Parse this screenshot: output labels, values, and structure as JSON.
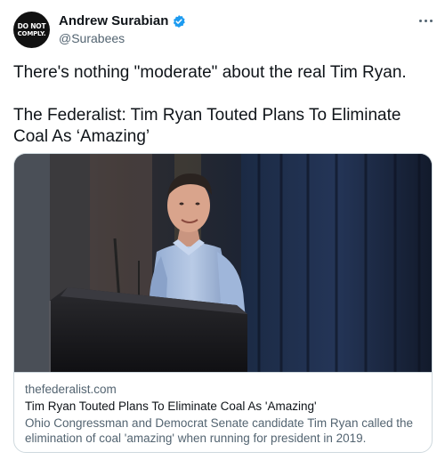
{
  "author": {
    "avatar_line1": "DO NOT",
    "avatar_line2": "COMPLY.",
    "display_name": "Andrew Surabian",
    "handle": "@Surabees",
    "verified": true
  },
  "tweet": {
    "paragraphs": [
      "There's nothing \"moderate\" about the real Tim Ryan.",
      "The Federalist: Tim Ryan Touted Plans To Eliminate Coal As ‘Amazing’"
    ]
  },
  "card": {
    "domain": "thefederalist.com",
    "title": "Tim Ryan Touted Plans To Eliminate Coal As 'Amazing'",
    "description": "Ohio Congressman and Democrat Senate candidate Tim Ryan called the elimination of coal 'amazing' when running for president in 2019."
  },
  "colors": {
    "verified_badge": "#1d9bf0",
    "secondary_text": "#536471",
    "card_border": "#cfd9de"
  },
  "icons": {
    "more": "more-horizontal-icon",
    "verified": "verified-badge-icon"
  }
}
